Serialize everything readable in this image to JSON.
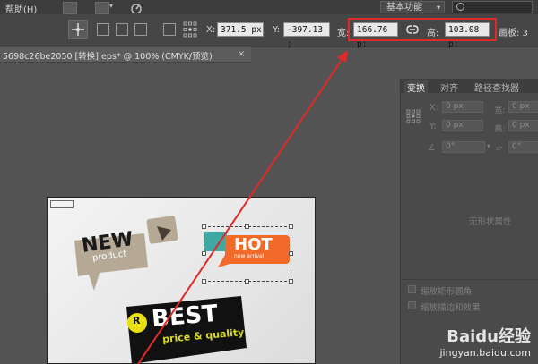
{
  "menubar": {
    "help": "帮助(H)",
    "workspace": "基本功能",
    "workspace_icon": "chevron-down-icon",
    "search_icon": "search-icon"
  },
  "controlbar": {
    "x_label": "X:",
    "x_value": "371.5 px",
    "y_label": "Y:",
    "y_value": "-397.13 ;",
    "w_label": "宽:",
    "w_value": "166.76 p:",
    "h_label": "高:",
    "h_value": "103.08 p:",
    "artboard_label": "画板: 3",
    "link_icon": "link-icon",
    "highlight_color": "#e02a2a"
  },
  "document": {
    "tab_title": "5698c26be2050 [转换].eps* @ 100% (CMYK/预览)",
    "close": "×"
  },
  "panel": {
    "tabs": [
      "变换",
      "对齐",
      "路径查找器"
    ],
    "active_tab": "变换",
    "fields": [
      {
        "label": "X:",
        "value": "0 px"
      },
      {
        "label": "Y:",
        "value": "0 px"
      },
      {
        "label": "宽:",
        "value": "0 px"
      },
      {
        "label": "高:",
        "value": "0 px"
      }
    ],
    "angle_value": "0°",
    "shear_value": "0°",
    "no_shape_props": "无形状属性",
    "options": [
      "缩放矩形圆角",
      "缩放描边和效果"
    ]
  },
  "artwork": {
    "new_title": "NEW",
    "new_sub": "product",
    "hot_title": "HOT",
    "hot_sub": "new arrival",
    "best_title": "BEST",
    "best_sub": "price & quality",
    "best_badge": "R"
  },
  "watermark": {
    "brand": "Baidu经验",
    "url": "jingyan.baidu.com"
  }
}
